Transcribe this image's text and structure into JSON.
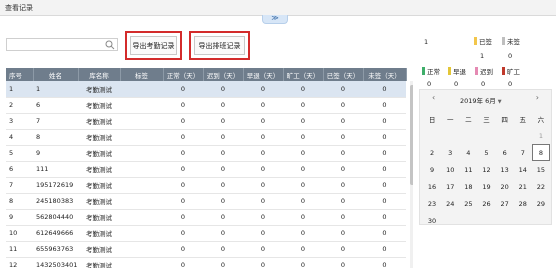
{
  "window": {
    "title": "查看记录",
    "collapse_glyph": "≫"
  },
  "search": {
    "placeholder": "",
    "value": ""
  },
  "buttons": {
    "export_attendance": "导出考勤记录",
    "export_schedule": "导出排班记录"
  },
  "table": {
    "headers": [
      "序号",
      "姓名",
      "库名称",
      "标签",
      "正常（天）",
      "迟到（天）",
      "早退（天）",
      "旷工（天）",
      "已签（天）",
      "未签（天）"
    ],
    "rows": [
      {
        "id": "1",
        "name": "1",
        "lib": "考勤测试",
        "tag": "",
        "normal": "0",
        "late": "0",
        "early": "0",
        "absent": "0",
        "signed": "0",
        "unsigned": "0"
      },
      {
        "id": "2",
        "name": "6",
        "lib": "考勤测试",
        "tag": "",
        "normal": "0",
        "late": "0",
        "early": "0",
        "absent": "0",
        "signed": "0",
        "unsigned": "0"
      },
      {
        "id": "3",
        "name": "7",
        "lib": "考勤测试",
        "tag": "",
        "normal": "0",
        "late": "0",
        "early": "0",
        "absent": "0",
        "signed": "0",
        "unsigned": "0"
      },
      {
        "id": "4",
        "name": "8",
        "lib": "考勤测试",
        "tag": "",
        "normal": "0",
        "late": "0",
        "early": "0",
        "absent": "0",
        "signed": "0",
        "unsigned": "0"
      },
      {
        "id": "5",
        "name": "9",
        "lib": "考勤测试",
        "tag": "",
        "normal": "0",
        "late": "0",
        "early": "0",
        "absent": "0",
        "signed": "0",
        "unsigned": "0"
      },
      {
        "id": "6",
        "name": "111",
        "lib": "考勤测试",
        "tag": "",
        "normal": "0",
        "late": "0",
        "early": "0",
        "absent": "0",
        "signed": "0",
        "unsigned": "0"
      },
      {
        "id": "7",
        "name": "195172619",
        "lib": "考勤测试",
        "tag": "",
        "normal": "0",
        "late": "0",
        "early": "0",
        "absent": "0",
        "signed": "0",
        "unsigned": "0"
      },
      {
        "id": "8",
        "name": "245180383",
        "lib": "考勤测试",
        "tag": "",
        "normal": "0",
        "late": "0",
        "early": "0",
        "absent": "0",
        "signed": "0",
        "unsigned": "0"
      },
      {
        "id": "9",
        "name": "562804440",
        "lib": "考勤测试",
        "tag": "",
        "normal": "0",
        "late": "0",
        "early": "0",
        "absent": "0",
        "signed": "0",
        "unsigned": "0"
      },
      {
        "id": "10",
        "name": "612649666",
        "lib": "考勤测试",
        "tag": "",
        "normal": "0",
        "late": "0",
        "early": "0",
        "absent": "0",
        "signed": "0",
        "unsigned": "0"
      },
      {
        "id": "11",
        "name": "655963763",
        "lib": "考勤测试",
        "tag": "",
        "normal": "0",
        "late": "0",
        "early": "0",
        "absent": "0",
        "signed": "0",
        "unsigned": "0"
      },
      {
        "id": "12",
        "name": "1432503401",
        "lib": "考勤测试",
        "tag": "",
        "normal": "0",
        "late": "0",
        "early": "0",
        "absent": "0",
        "signed": "0",
        "unsigned": "0"
      }
    ],
    "selected_row": 0
  },
  "legend": {
    "top_left_value": "1",
    "signed": {
      "label": "已签",
      "color": "#f2c64b",
      "value": "1"
    },
    "unsigned": {
      "label": "未签",
      "color": "#bfbfbf",
      "value": "0"
    },
    "normal": {
      "label": "正常",
      "color": "#3fae6a",
      "value": "0"
    },
    "late": {
      "label": "早退",
      "color": "#e3c637",
      "value": "0"
    },
    "early": {
      "label": "迟到",
      "color": "#e58ab3",
      "value": "0"
    },
    "absent": {
      "label": "旷工",
      "color": "#c0392b",
      "value": "0"
    }
  },
  "calendar": {
    "title": "2019年 6月",
    "weekdays": [
      "日",
      "一",
      "二",
      "三",
      "四",
      "五",
      "六"
    ],
    "days": [
      "",
      "",
      "",
      "",
      "",
      "",
      "1",
      "2",
      "3",
      "4",
      "5",
      "6",
      "7",
      "8",
      "9",
      "10",
      "11",
      "12",
      "13",
      "14",
      "15",
      "16",
      "17",
      "18",
      "19",
      "20",
      "21",
      "22",
      "23",
      "24",
      "25",
      "26",
      "27",
      "28",
      "29",
      "30"
    ],
    "today": "8",
    "muted_days": [
      "1"
    ]
  }
}
